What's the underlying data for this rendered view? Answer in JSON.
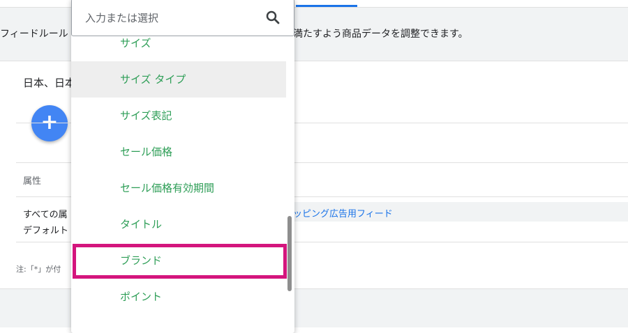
{
  "banner": {
    "text_left": "フィードルール",
    "text_right": "満たすよう商品データを調整できます。"
  },
  "country_text": "日本、日本",
  "add_button_symbol": "+",
  "attribute_header": "属性",
  "rows": {
    "line1": "すべての属",
    "line2": "デフォルト",
    "source_link": "ッピング広告用フィード"
  },
  "note": "注:「*」が付",
  "dropdown": {
    "search_placeholder": "入力または選択",
    "options": [
      {
        "label": "サイズ"
      },
      {
        "label": "サイズ タイプ"
      },
      {
        "label": "サイズ表記"
      },
      {
        "label": "セール価格"
      },
      {
        "label": "セール価格有効期間"
      },
      {
        "label": "タイトル"
      },
      {
        "label": "ブランド"
      },
      {
        "label": "ポイント"
      }
    ],
    "hovered_index": 1,
    "highlighted_index": 6
  },
  "colors": {
    "option_text": "#2e9e57",
    "highlight_border": "#d4157d",
    "fab": "#4285f4",
    "link": "#1a73e8"
  },
  "icons": {
    "search": "search-icon",
    "add": "plus-icon"
  }
}
